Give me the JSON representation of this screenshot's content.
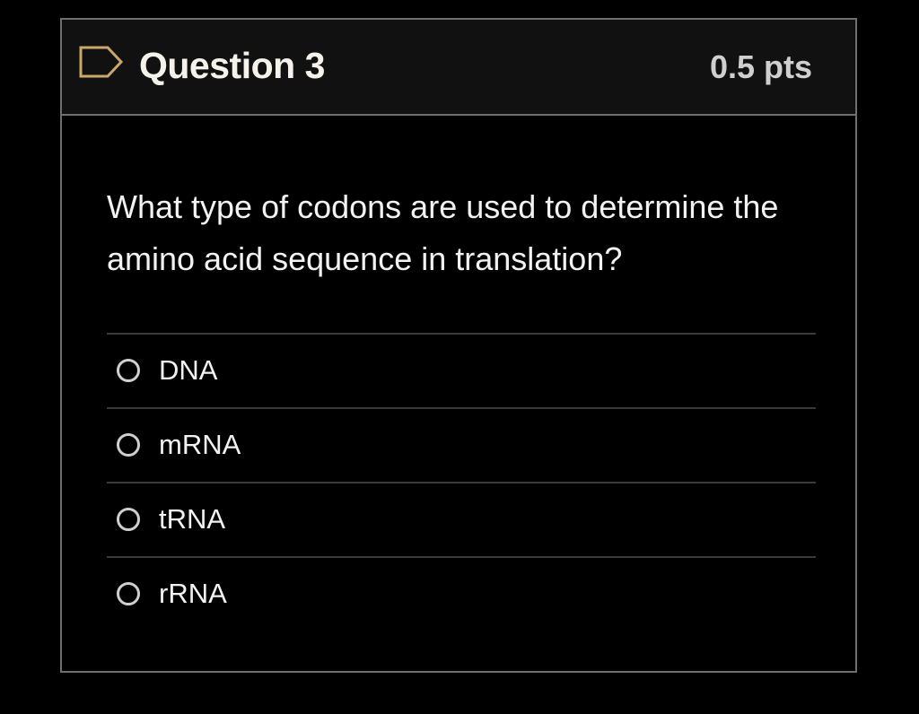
{
  "question": {
    "title": "Question 3",
    "points": "0.5 pts",
    "text": "What type of codons are used to determine the amino acid sequence in translation?",
    "flag_icon": "flag-outline-icon"
  },
  "answers": [
    {
      "label": "DNA",
      "selected": false
    },
    {
      "label": "mRNA",
      "selected": false
    },
    {
      "label": "tRNA",
      "selected": false
    },
    {
      "label": "rRNA",
      "selected": false
    }
  ],
  "colors": {
    "background": "#000000",
    "header_background": "#111111",
    "border": "#6f6f6f",
    "flag": "#c9a86a",
    "text": "#f2f2f2"
  }
}
